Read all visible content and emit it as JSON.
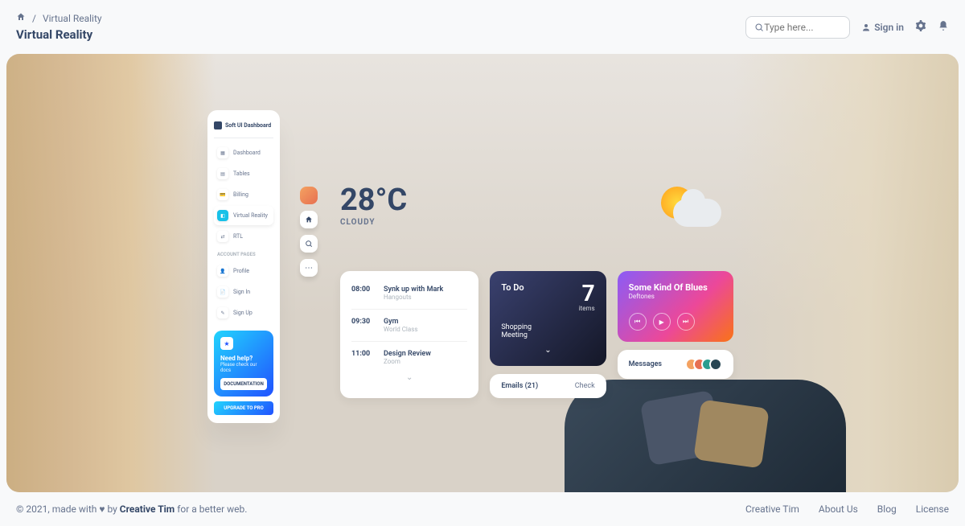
{
  "breadcrumb": {
    "current": "Virtual Reality"
  },
  "page_title": "Virtual Reality",
  "search": {
    "placeholder": "Type here..."
  },
  "signin_label": "Sign in",
  "sidenav": {
    "brand": "Soft UI Dashboard",
    "items": [
      {
        "label": "Dashboard",
        "icon": "▦"
      },
      {
        "label": "Tables",
        "icon": "▤"
      },
      {
        "label": "Billing",
        "icon": "💳"
      },
      {
        "label": "Virtual Reality",
        "icon": "◧",
        "active": true
      },
      {
        "label": "RTL",
        "icon": "⇄"
      }
    ],
    "section_title": "ACCOUNT PAGES",
    "account_items": [
      {
        "label": "Profile",
        "icon": "👤"
      },
      {
        "label": "Sign In",
        "icon": "📄"
      },
      {
        "label": "Sign Up",
        "icon": "✎"
      }
    ],
    "help": {
      "title": "Need help?",
      "subtitle": "Please check our docs",
      "button": "DOCUMENTATION"
    },
    "upgrade": "UPGRADE TO PRO"
  },
  "weather": {
    "temp": "28°C",
    "condition": "CLOUDY"
  },
  "schedule": [
    {
      "time": "08:00",
      "title": "Synk up with Mark",
      "sub": "Hangouts"
    },
    {
      "time": "09:30",
      "title": "Gym",
      "sub": "World Class"
    },
    {
      "time": "11:00",
      "title": "Design Review",
      "sub": "Zoom"
    }
  ],
  "todo": {
    "title": "To Do",
    "count": "7",
    "items_label": "items",
    "list": [
      "Shopping",
      "Meeting"
    ]
  },
  "emails": {
    "label": "Emails (21)",
    "action": "Check"
  },
  "music": {
    "title": "Some Kind Of Blues",
    "artist": "Deftones"
  },
  "messages": {
    "label": "Messages"
  },
  "footer": {
    "copyright_prefix": "© 2021, made with ",
    "copyright_mid": " by ",
    "brand": "Creative Tim",
    "copyright_suffix": " for a better web.",
    "links": [
      "Creative Tim",
      "About Us",
      "Blog",
      "License"
    ]
  }
}
